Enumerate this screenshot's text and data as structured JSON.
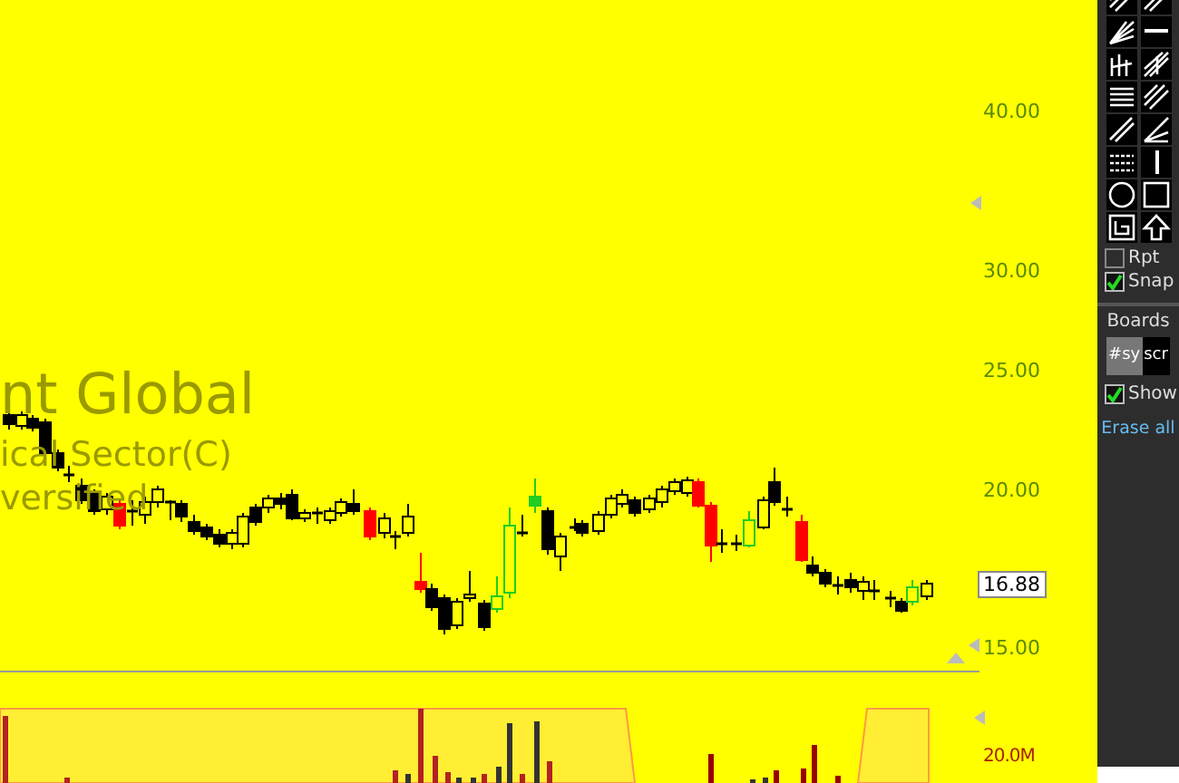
{
  "chart": {
    "symbol_lines": [
      "nt Global",
      "ical Sector(C)",
      "versified"
    ],
    "price_axis": [
      {
        "label": "40.00"
      },
      {
        "label": "30.00"
      },
      {
        "label": "25.00"
      },
      {
        "label": "20.00"
      },
      {
        "label": "15.00"
      }
    ],
    "last_price": "16.88",
    "volume_axis": [
      "20.0M"
    ]
  },
  "toolbar": {
    "options": [
      {
        "label": "Rpt",
        "checked": false
      },
      {
        "label": "Snap",
        "checked": true
      }
    ],
    "boards_label": "Boards",
    "boards": [
      {
        "label": "#sy",
        "selected": true
      },
      {
        "label": "scr",
        "selected": false
      }
    ],
    "show": {
      "label": "Show",
      "checked": true
    },
    "erase": "Erase all"
  }
}
